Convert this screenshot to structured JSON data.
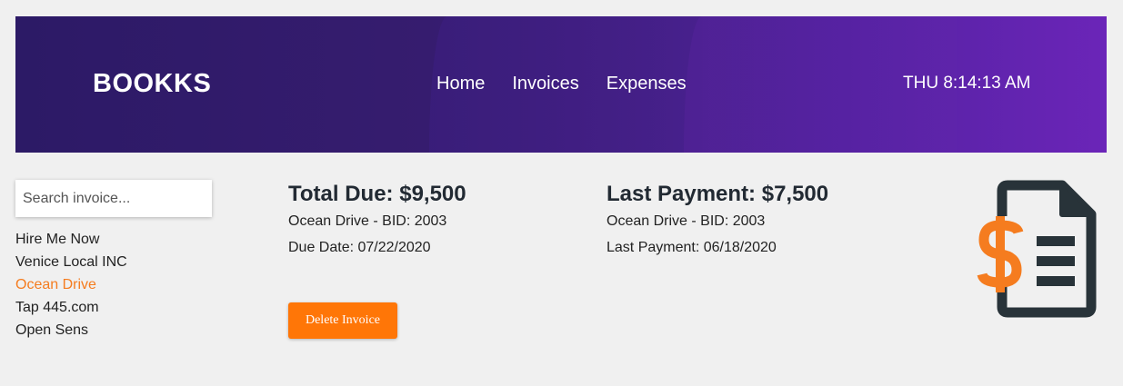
{
  "header": {
    "brand": "BOOKKS",
    "nav": [
      {
        "label": "Home"
      },
      {
        "label": "Invoices"
      },
      {
        "label": "Expenses"
      }
    ],
    "clock": "THU 8:14:13 AM"
  },
  "sidebar": {
    "search_placeholder": "Search invoice...",
    "search_value": "",
    "clients": [
      {
        "label": "Hire Me Now",
        "active": false
      },
      {
        "label": "Venice Local INC",
        "active": false
      },
      {
        "label": "Ocean Drive",
        "active": true
      },
      {
        "label": "Tap 445.com",
        "active": false
      },
      {
        "label": "Open Sens",
        "active": false
      }
    ]
  },
  "total_due": {
    "title": "Total Due: $9,500",
    "client_bid": "Ocean Drive - BID: 2003",
    "date_line": "Due Date: 07/22/2020"
  },
  "last_payment": {
    "title": "Last Payment: $7,500",
    "client_bid": "Ocean Drive - BID: 2003",
    "date_line": "Last Payment: 06/18/2020"
  },
  "actions": {
    "delete_label": "Delete Invoice"
  },
  "icon": {
    "name": "invoice-dollar-icon",
    "doc_color": "#283339",
    "dollar_color": "#f57c1f"
  },
  "colors": {
    "accent": "#ff7607",
    "active_link": "#f57c1f",
    "header_start": "#2c1a66",
    "header_end": "#6b25b8"
  }
}
